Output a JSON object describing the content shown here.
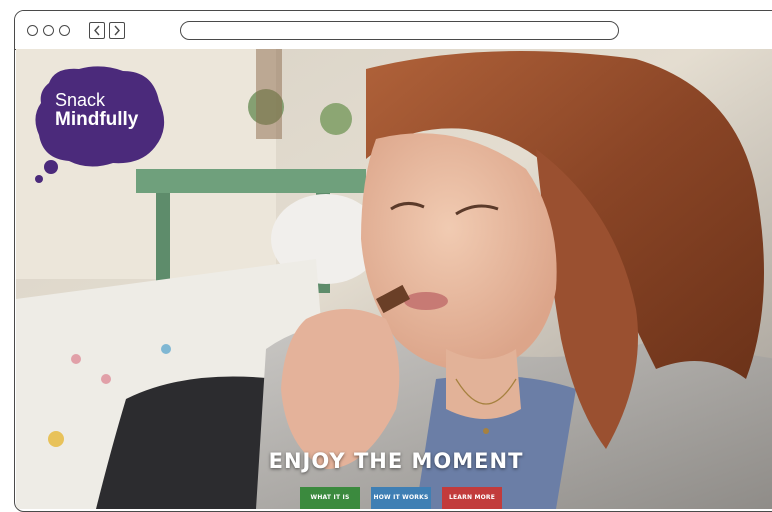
{
  "browser": {
    "url": ""
  },
  "logo": {
    "line1": "Snack",
    "line2": "Mindfully"
  },
  "hero": {
    "headline": "ENJOY THE MOMENT",
    "buttons": [
      {
        "label": "WHAT IT IS",
        "color": "#3b8a3e"
      },
      {
        "label": "HOW IT WORKS",
        "color": "#3f7fb4"
      },
      {
        "label": "LEARN MORE",
        "color": "#c23b3b"
      }
    ]
  },
  "colors": {
    "brand_purple": "#4b2a7b",
    "window_stroke": "#4a4a4a"
  },
  "icons": [
    "window-dot-icon",
    "back-arrow-icon",
    "forward-arrow-icon"
  ]
}
